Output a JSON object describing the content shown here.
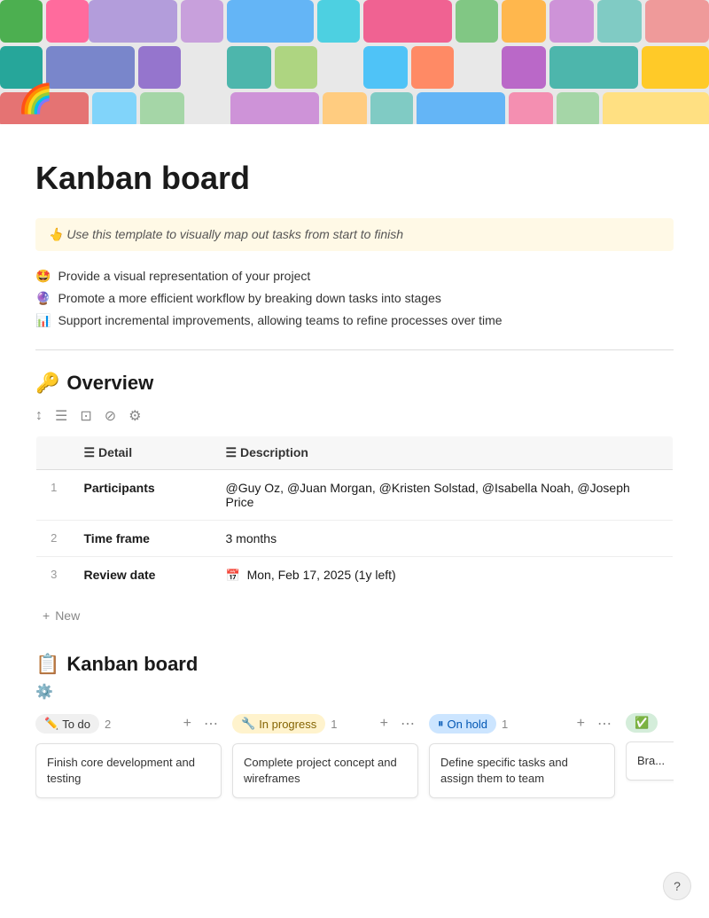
{
  "page": {
    "title": "Kanban board",
    "tip": "👆 Use this template to visually map out tasks from start to finish",
    "features": [
      {
        "icon": "🤩",
        "text": "Provide a visual representation of your project"
      },
      {
        "icon": "🔮",
        "text": "Promote a more efficient workflow by breaking down tasks into stages"
      },
      {
        "icon": "📊",
        "text": "Support incremental improvements, allowing teams to refine processes over time"
      }
    ]
  },
  "overview": {
    "section_icon": "🔑",
    "section_title": "Overview",
    "columns": [
      {
        "icon": "☰",
        "label": "Detail"
      },
      {
        "icon": "☰",
        "label": "Description"
      }
    ],
    "rows": [
      {
        "num": "1",
        "detail": "Participants",
        "description": "@Guy Oz, @Juan Morgan, @Kristen Solstad, @Isabella Noah, @Joseph Price"
      },
      {
        "num": "2",
        "detail": "Time frame",
        "description": "3 months"
      },
      {
        "num": "3",
        "detail": "Review date",
        "description": "Mon, Feb 17, 2025 (1y left)"
      }
    ],
    "add_new_label": "New"
  },
  "kanban": {
    "section_icon": "📋",
    "section_title": "Kanban board",
    "columns": [
      {
        "id": "todo",
        "badge_icon": "✏️",
        "badge_label": "To do",
        "badge_class": "badge-todo",
        "count": "2",
        "cards": [
          {
            "text": "Finish core development and testing"
          }
        ]
      },
      {
        "id": "inprogress",
        "badge_icon": "🔧",
        "badge_label": "In progress",
        "badge_class": "badge-inprogress",
        "count": "1",
        "cards": [
          {
            "text": "Complete project concept and wireframes"
          }
        ]
      },
      {
        "id": "onhold",
        "badge_icon": "⏸",
        "badge_label": "On hold",
        "badge_class": "badge-onhold",
        "count": "1",
        "cards": [
          {
            "text": "Define specific tasks and assign them to team"
          }
        ]
      },
      {
        "id": "done",
        "badge_icon": "✅",
        "badge_label": "",
        "badge_class": "badge-done",
        "count": "",
        "cards": [
          {
            "text": "Bra..."
          }
        ]
      }
    ]
  },
  "ui": {
    "add_icon": "+",
    "more_icon": "⋯",
    "sort_icon": "↕",
    "filter_icon": "☰",
    "expand_icon": "⊡",
    "hide_icon": "⊘",
    "settings_icon": "⚙",
    "help_label": "?"
  }
}
